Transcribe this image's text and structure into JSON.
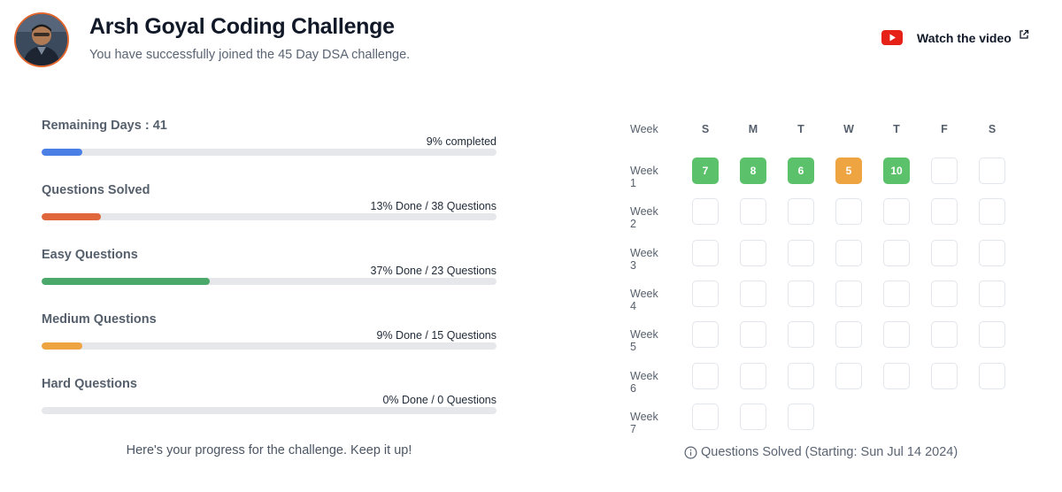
{
  "header": {
    "title": "Arsh Goyal Coding Challenge",
    "subtitle": "You have successfully joined the 45 Day DSA challenge.",
    "watch_label": "Watch the video",
    "avatar_icon": "profile-photo",
    "video_icon": "youtube-icon",
    "external_icon": "external-link-icon"
  },
  "metrics": [
    {
      "label": "Remaining Days : 41",
      "detail": "9% completed",
      "percent": 9,
      "color": "#4a7fe6"
    },
    {
      "label": "Questions Solved",
      "detail": "13% Done / 38 Questions",
      "percent": 13,
      "color": "#e0663c"
    },
    {
      "label": "Easy Questions",
      "detail": "37% Done / 23 Questions",
      "percent": 37,
      "color": "#4aa86b"
    },
    {
      "label": "Medium Questions",
      "detail": "9% Done / 15 Questions",
      "percent": 9,
      "color": "#eea440"
    },
    {
      "label": "Hard Questions",
      "detail": "0% Done / 0 Questions",
      "percent": 0,
      "color": "#9ca3af"
    }
  ],
  "progress_message": "Here's your progress for the challenge. Keep it up!",
  "calendar": {
    "week_header": "Week",
    "days": [
      "S",
      "M",
      "T",
      "W",
      "T",
      "F",
      "S"
    ],
    "weeks": [
      {
        "label": "Week 1",
        "cells": [
          {
            "value": "7",
            "status": "green"
          },
          {
            "value": "8",
            "status": "green"
          },
          {
            "value": "6",
            "status": "green"
          },
          {
            "value": "5",
            "status": "orange"
          },
          {
            "value": "10",
            "status": "green"
          },
          {
            "value": "",
            "status": "empty"
          },
          {
            "value": "",
            "status": "empty"
          }
        ]
      },
      {
        "label": "Week 2",
        "cells": [
          {
            "value": "",
            "status": "empty"
          },
          {
            "value": "",
            "status": "empty"
          },
          {
            "value": "",
            "status": "empty"
          },
          {
            "value": "",
            "status": "empty"
          },
          {
            "value": "",
            "status": "empty"
          },
          {
            "value": "",
            "status": "empty"
          },
          {
            "value": "",
            "status": "empty"
          }
        ]
      },
      {
        "label": "Week 3",
        "cells": [
          {
            "value": "",
            "status": "empty"
          },
          {
            "value": "",
            "status": "empty"
          },
          {
            "value": "",
            "status": "empty"
          },
          {
            "value": "",
            "status": "empty"
          },
          {
            "value": "",
            "status": "empty"
          },
          {
            "value": "",
            "status": "empty"
          },
          {
            "value": "",
            "status": "empty"
          }
        ]
      },
      {
        "label": "Week 4",
        "cells": [
          {
            "value": "",
            "status": "empty"
          },
          {
            "value": "",
            "status": "empty"
          },
          {
            "value": "",
            "status": "empty"
          },
          {
            "value": "",
            "status": "empty"
          },
          {
            "value": "",
            "status": "empty"
          },
          {
            "value": "",
            "status": "empty"
          },
          {
            "value": "",
            "status": "empty"
          }
        ]
      },
      {
        "label": "Week 5",
        "cells": [
          {
            "value": "",
            "status": "empty"
          },
          {
            "value": "",
            "status": "empty"
          },
          {
            "value": "",
            "status": "empty"
          },
          {
            "value": "",
            "status": "empty"
          },
          {
            "value": "",
            "status": "empty"
          },
          {
            "value": "",
            "status": "empty"
          },
          {
            "value": "",
            "status": "empty"
          }
        ]
      },
      {
        "label": "Week 6",
        "cells": [
          {
            "value": "",
            "status": "empty"
          },
          {
            "value": "",
            "status": "empty"
          },
          {
            "value": "",
            "status": "empty"
          },
          {
            "value": "",
            "status": "empty"
          },
          {
            "value": "",
            "status": "empty"
          },
          {
            "value": "",
            "status": "empty"
          },
          {
            "value": "",
            "status": "empty"
          }
        ]
      },
      {
        "label": "Week 7",
        "cells": [
          {
            "value": "",
            "status": "empty"
          },
          {
            "value": "",
            "status": "empty"
          },
          {
            "value": "",
            "status": "empty"
          }
        ]
      }
    ],
    "footer": "Questions Solved (Starting: Sun Jul 14 2024)",
    "footer_icon": "info-icon",
    "colors": {
      "green": "#5bc26b",
      "orange": "#eea440"
    }
  }
}
